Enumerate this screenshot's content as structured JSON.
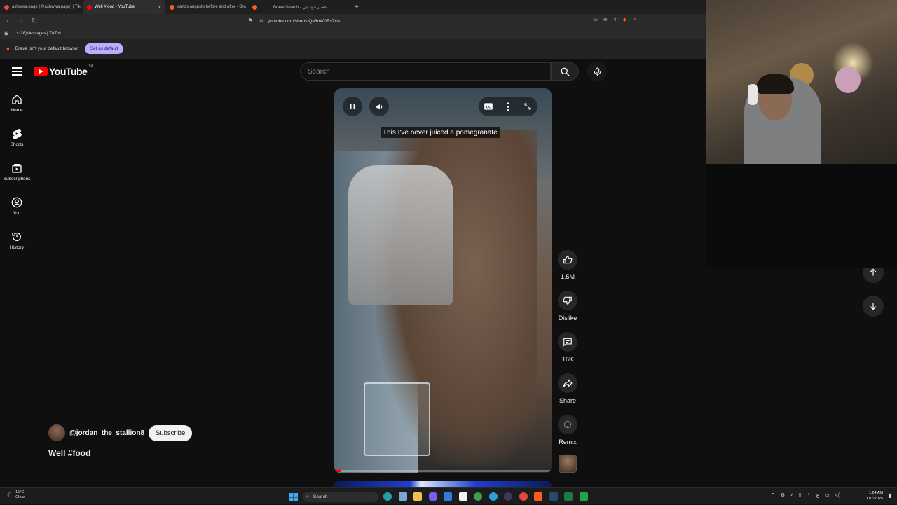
{
  "browser": {
    "tabs": [
      {
        "label": "ashwwa.page (@ashwwa.page) | Tik",
        "active": false,
        "fav_color": "#e74c3c"
      },
      {
        "label": "Well #food - YouTube",
        "active": true,
        "fav_color": "#ff0000"
      },
      {
        "label": "carlos augusto before and after - Bra",
        "active": false,
        "fav_color": "#ff5a1f"
      },
      {
        "label": "",
        "active": false,
        "fav_color": "#ff5a1f"
      },
      {
        "label": "Brave Search - عصير فود جي",
        "active": false,
        "fav_color": "#ff5a1f"
      }
    ],
    "url": "youtube.com/shorts/Qa8mK0Rs7cA",
    "bookmark": "(38)Messages | TikTok",
    "info_text": "Brave isn't your default browser",
    "set_default_label": "Set as default"
  },
  "youtube": {
    "logo_text": "YouTube",
    "country_code": "SA",
    "search_placeholder": "Search",
    "sidebar": [
      {
        "label": "Home",
        "icon": "home-icon"
      },
      {
        "label": "Shorts",
        "icon": "shorts-icon"
      },
      {
        "label": "Subscriptions",
        "icon": "subscriptions-icon"
      },
      {
        "label": "You",
        "icon": "you-icon"
      },
      {
        "label": "History",
        "icon": "history-icon"
      }
    ],
    "video": {
      "caption": "This I've never juiced a pomegranate",
      "progress": 0.03
    },
    "actions": {
      "likes": "1.5M",
      "dislike": "Dislike",
      "comments": "16K",
      "share": "Share",
      "remix": "Remix"
    },
    "channel": "@jordan_the_stallion8",
    "subscribe_label": "Subscribe",
    "title": "Well #food"
  },
  "taskbar": {
    "weather_temp": "15°C",
    "weather_desc": "Clear",
    "search_label": "Search",
    "time": "1:24 AM",
    "date": "11/7/2025",
    "lang": "ع"
  }
}
